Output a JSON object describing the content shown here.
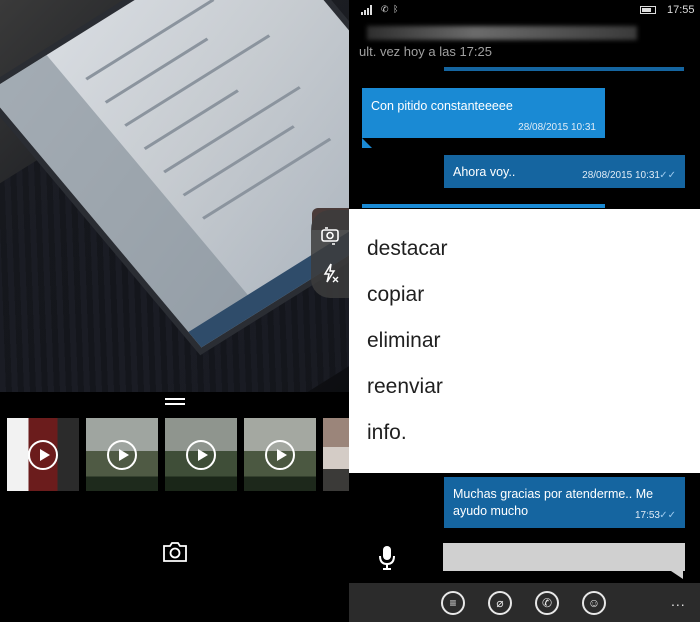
{
  "camera": {
    "tools": [
      {
        "icon": "switch-camera-icon"
      },
      {
        "icon": "flash-off-icon"
      }
    ],
    "thumbnails": [
      {
        "icon": "play-icon",
        "bg": "#5a2020"
      },
      {
        "icon": "play-icon",
        "bg": "#5b6b52"
      },
      {
        "icon": "play-icon",
        "bg": "#4d5c45"
      },
      {
        "icon": "play-icon",
        "bg": "#55604c"
      },
      {
        "icon": "",
        "bg": "#6a6562"
      }
    ],
    "shutter_icon": "camera-icon"
  },
  "chat": {
    "status_bar": {
      "time": "17:55"
    },
    "last_seen": "ult. vez hoy a las 17:25",
    "messages": [
      {
        "text": "Con pitido constanteeeee",
        "time": "28/08/2015 10:31",
        "direction": "in"
      },
      {
        "text": "Ahora voy..",
        "time": "28/08/2015 10:31",
        "direction": "out",
        "status": "✓✓"
      },
      {
        "text": "Muchas gracias por atenderme.. Me ayudo mucho",
        "time": "17:53",
        "direction": "out",
        "status": "✓✓"
      }
    ],
    "context_menu": [
      "destacar",
      "copiar",
      "eliminar",
      "reenviar",
      "info."
    ],
    "app_bar": {
      "buttons": [
        "message-list-icon",
        "attach-icon",
        "phone-icon",
        "emoji-icon"
      ],
      "more": "..."
    }
  },
  "colors": {
    "bubble_in": "#1a8ad4",
    "bubble_out": "#1565a0",
    "menu_bg": "#ffffff",
    "app_bar": "#2b2b2b"
  }
}
